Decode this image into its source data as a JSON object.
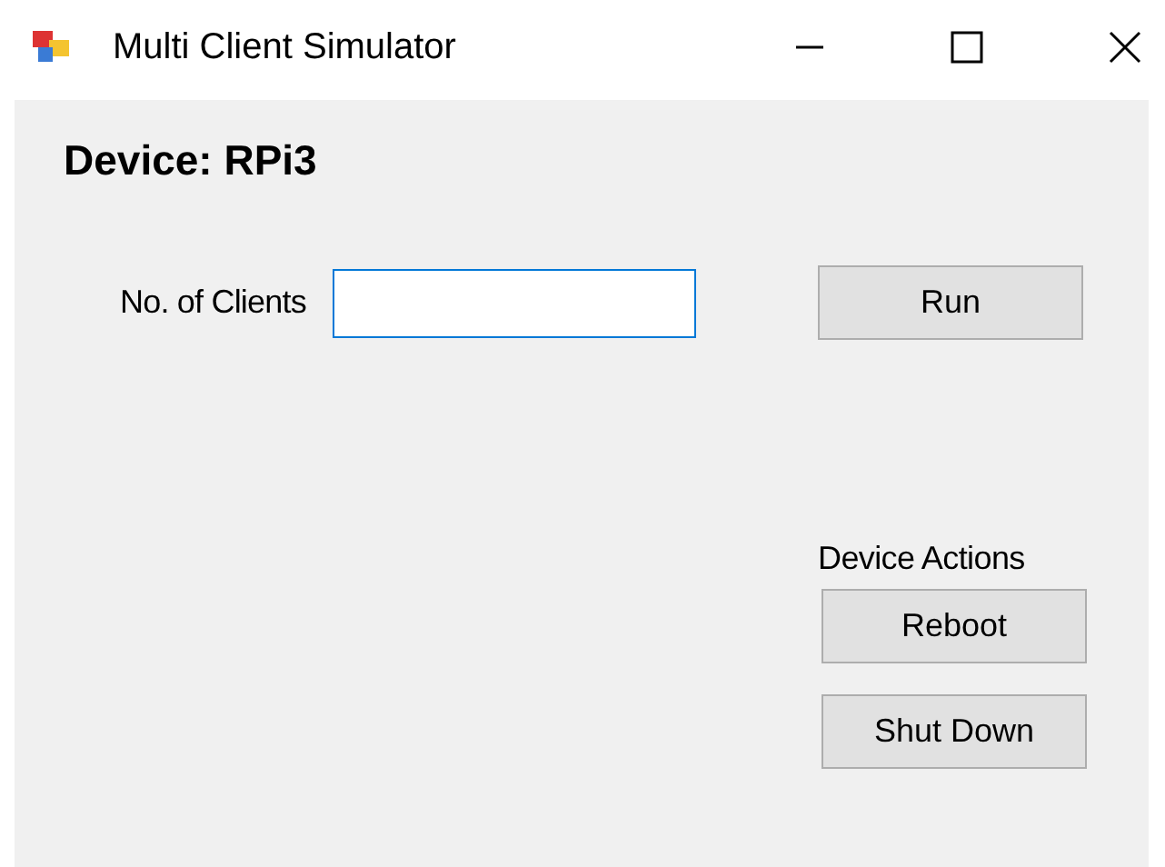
{
  "window": {
    "title": "Multi Client Simulator"
  },
  "heading": "Device: RPi3",
  "clients_field": {
    "label": "No. of Clients"
  },
  "run_button": "Run",
  "device_actions": {
    "label": "Device Actions",
    "buttons": [
      "Reboot",
      "Shut Down"
    ]
  }
}
